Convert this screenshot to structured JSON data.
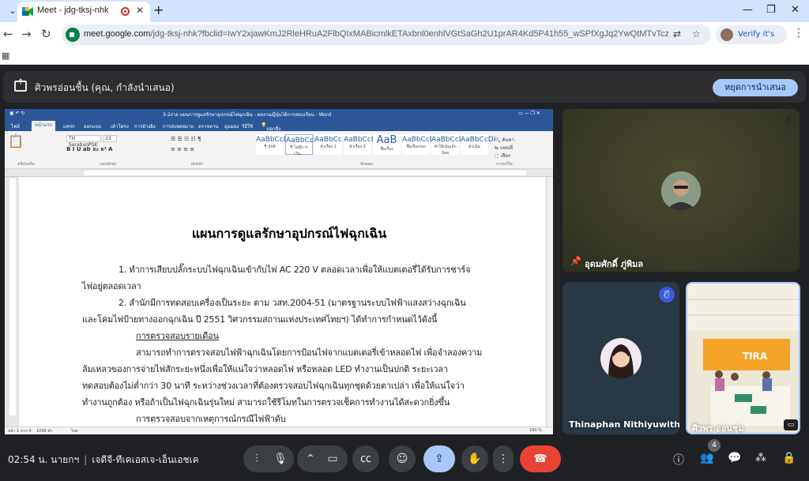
{
  "browser": {
    "tab_title": "Meet - jdg-tksj-nhk",
    "url_host": "meet.google.com",
    "url_rest": "/jdg-tksj-nhk?fbclid=IwY2xjawKmJ2RleHRuA2FlbQIxMABicmlkETAxbnl0enhlVGtSaGh2U1prAR4Kd5P41h55_wSPfXgJq2YwQtMTvTczZFCSS-eZpZi4dS4...",
    "verify_label": "Verify it's you",
    "colors": {
      "tabbar": "#d3e3fd",
      "omnibox": "#e9eef6"
    }
  },
  "meet": {
    "presenting_banner": "ศิวพรอ่อนชื้น (คุณ, กำลังนำเสนอ)",
    "stop_presenting": "หยุดการนำเสนอ",
    "meeting_time": "02:54 น. นายกฯ",
    "meeting_code": "เจดีจี-ทีเคเอสเจ-เอ็นเอชเค",
    "people_count": "4",
    "participants": [
      {
        "name": "อุดมศักดิ์ ภู่พิมล",
        "pinned": true,
        "muted": true
      },
      {
        "name": "Thinaphan Nithiyuwith",
        "muted": true
      },
      {
        "name": "ศิวพร อ่อนชุ่ม",
        "muted": false,
        "video": true
      }
    ],
    "colors": {
      "background": "#202124",
      "accent": "#a8c7fa",
      "end_call": "#ea4335"
    }
  },
  "word": {
    "title_text": "3-2ง่าย แผนการดูแลรักษาอุปกรณ์ไฟฉุกเฉิน - ผลงานญี่ปุ่นได้การสอบเรียน - Word",
    "tabs": [
      "ไฟล์",
      "หน้าแรก",
      "แทรก",
      "ออกแบบ",
      "เค้าโครง",
      "การอ้างอิง",
      "การส่งจดหมาย",
      "ตรวจทาน",
      "มุมมอง",
      "วิธีใช้"
    ],
    "search_hint": "บอกสิ่งที่คุณต้องการทำ",
    "font_name": "TH SarabunPSK",
    "font_size": "22",
    "styles": [
      {
        "sample": "AaBbCcDd",
        "name": "¶ ปกติ"
      },
      {
        "sample": "AaBbCcDd",
        "name": "¶ ไม่มีการเว้น..."
      },
      {
        "sample": "AaBbCc",
        "name": "หัวเรื่อง 1"
      },
      {
        "sample": "AaBbCcE",
        "name": "หัวเรื่อง 2"
      },
      {
        "sample": "AaB",
        "name": "ชื่อเรื่อง"
      },
      {
        "sample": "AaBbCcE",
        "name": "ชื่อเรื่องรอง"
      },
      {
        "sample": "AaBbCcDi",
        "name": "ทำให้เน้นเล็กน้อย"
      },
      {
        "sample": "AaBbCcDi",
        "name": "ตัวเน้น"
      }
    ],
    "editing": [
      "ค้นหา",
      "แทนที่",
      "เลือก"
    ],
    "group_labels": [
      "คลิปบอร์ด",
      "แบบอักษร",
      "ย่อหน้า",
      "ลักษณะ",
      "การแก้ไข"
    ],
    "status_left": "หน้า 1 จาก 4",
    "status_words": "1099 คำ",
    "status_lang": "ไทย",
    "status_zoom": "180 %",
    "doc": {
      "heading": "แผนการดูแลรักษาอุปกรณ์ไฟฉุกเฉิน",
      "lines": [
        "1.   ทำการเสียบปลั๊กระบบไฟฉุกเฉินเข้ากับไฟ AC 220 V ตลอดเวลาเพื่อให้แบตเตอรี่ได้รับการชาร์จ",
        "ไฟอยู่ตลอดเวลา",
        "2.   สำนักมีการทดสอบเครื่องเป็นระยะ ตาม วสท.2004-51 (มาตรฐานระบบไฟฟ้าแสงสว่างฉุกเฉิน",
        "และโคมไฟป้ายทางออกฉุกเฉิน ปี 2551 วิศวกรรมสถานแห่งประเทศไทยฯ) ได้ทำการกำหนดไว้ดังนี้",
        "การตรวจสอบรายเดือน",
        "สามารถทำการตรวจสอบไฟฟ้าฉุกเฉินโดยการป้อนไฟจากแบตเตอรี่เข้าหลอดไฟ เพื่อจำลองความ",
        "ล้มเหลวของการจ่ายไฟสักระยะหนึ่งเพื่อให้แน่ใจว่าหลอดไฟ หรือหลอด LED ทำงานเป็นปกติ ระยะเวลา",
        "ทดสอบต้องไม่ต่ำกว่า 30 นาที ระหว่างช่วงเวลาที่ต้องตรวจสอบไฟฉุกเฉินทุกชุดด้วยตาเปล่า เพื่อให้แน่ใจว่า",
        "ทำงานถูกต้อง หรือถ้าเป็นไฟฉุกเฉินรุ่นใหม่ สามารถใช้รีโมทในการตรวจเช็คการทำงานได้สะดวกยิ่งขึ้น",
        "การตรวจสอบจากเหตุการณ์กรณีไฟฟ้าดับ"
      ]
    }
  },
  "icons": {
    "mic": "microphone-icon",
    "camera": "camera-icon",
    "captions": "captions-icon",
    "emoji": "emoji-icon",
    "present": "present-icon",
    "hand": "raise-hand-icon",
    "more": "more-options-icon",
    "end": "end-call-icon",
    "info": "info-icon",
    "people": "people-icon",
    "chat": "chat-icon",
    "activities": "activities-icon",
    "lock": "host-controls-icon"
  }
}
